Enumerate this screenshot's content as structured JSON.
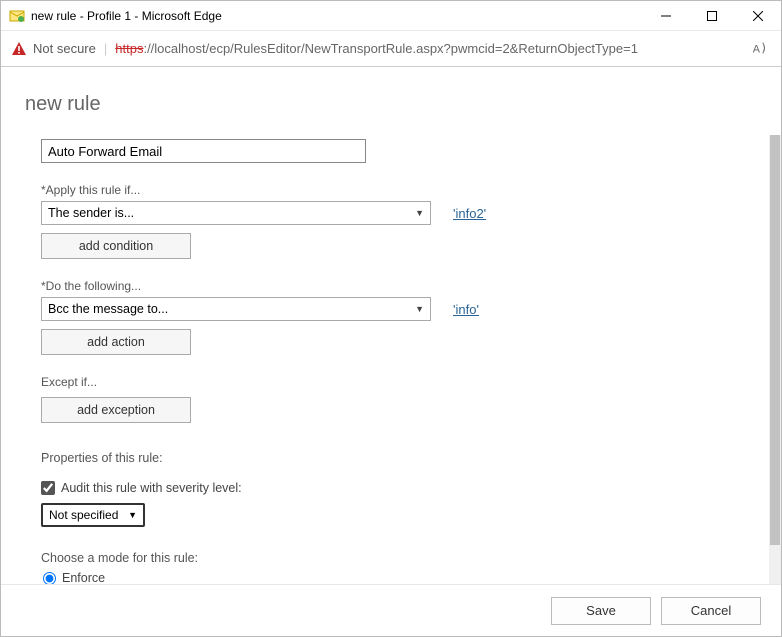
{
  "window": {
    "title": "new rule - Profile 1 - Microsoft Edge"
  },
  "addressbar": {
    "not_secure": "Not secure",
    "url_scheme": "https",
    "url_rest": "://localhost/ecp/RulesEditor/NewTransportRule.aspx?pwmcid=2&ReturnObjectType=1"
  },
  "page": {
    "heading": "new rule",
    "rule_name": "Auto Forward Email",
    "apply_if_label": "*Apply this rule if...",
    "apply_if_value": "The sender is...",
    "apply_if_link": "'info2'",
    "add_condition_btn": "add condition",
    "do_following_label": "*Do the following...",
    "do_following_value": "Bcc the message to...",
    "do_following_link": "'info'",
    "add_action_btn": "add action",
    "except_if_label": "Except if...",
    "add_exception_btn": "add exception",
    "properties_label": "Properties of this rule:",
    "audit_label": "Audit this rule with severity level:",
    "severity_value": "Not specified",
    "mode_label": "Choose a mode for this rule:",
    "mode_enforce": "Enforce"
  },
  "footer": {
    "save": "Save",
    "cancel": "Cancel"
  }
}
